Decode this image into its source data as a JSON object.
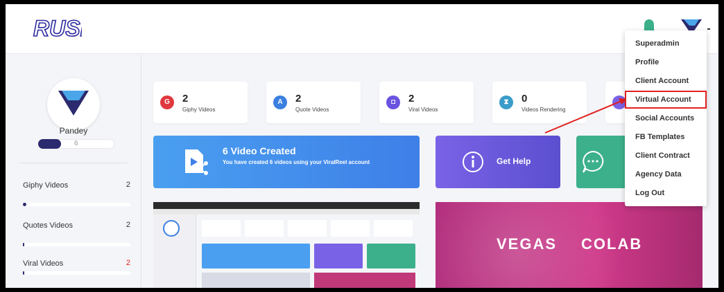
{
  "header": {
    "logo_text": "RUSH",
    "bell_icon": "bell-icon",
    "avatar_icon": "brand-v-logo-icon"
  },
  "colors": {
    "accent_navy": "#2c2a6e",
    "bell_green": "#3cb08a",
    "highlight_red": "#e02020",
    "banner_blue": "#4a9ff0",
    "help_purple": "#7a62e6"
  },
  "sidebar": {
    "username": "Pandey",
    "user_count": "6",
    "user_progress_fraction": 0.3,
    "stats": [
      {
        "label": "Giphy Videos",
        "count": "2",
        "progress": 0.03
      },
      {
        "label": "Quotes Videos",
        "count": "2",
        "progress": 0.01
      },
      {
        "label": "Viral Videos",
        "count": "2",
        "progress": 0.01
      }
    ]
  },
  "stat_cards": [
    {
      "count": "2",
      "label": "Giphy Videos",
      "icon_letter": "G",
      "color": "#e0383e"
    },
    {
      "count": "2",
      "label": "Quote Videos",
      "icon_letter": "A",
      "color": "#3b7fe0"
    },
    {
      "count": "2",
      "label": "Viral Videos",
      "icon_letter": "◘",
      "color": "#6a52e0"
    },
    {
      "count": "0",
      "label": "Videos Rendering",
      "icon_letter": "⧗",
      "color": "#3a9cc8"
    }
  ],
  "banner": {
    "title": "6 Video Created",
    "subtitle": "You have created 6 videos using your ViralReel account"
  },
  "help": {
    "label": "Get Help"
  },
  "promo": {
    "left_text": "VEGAS",
    "right_text": "COLAB"
  },
  "dropdown": {
    "items": [
      "Superadmin",
      "Profile",
      "Client Account",
      "Virtual Account",
      "Social Accounts",
      "FB Templates",
      "Client Contract",
      "Agency Data",
      "Log Out"
    ],
    "highlighted": "Virtual Account"
  }
}
